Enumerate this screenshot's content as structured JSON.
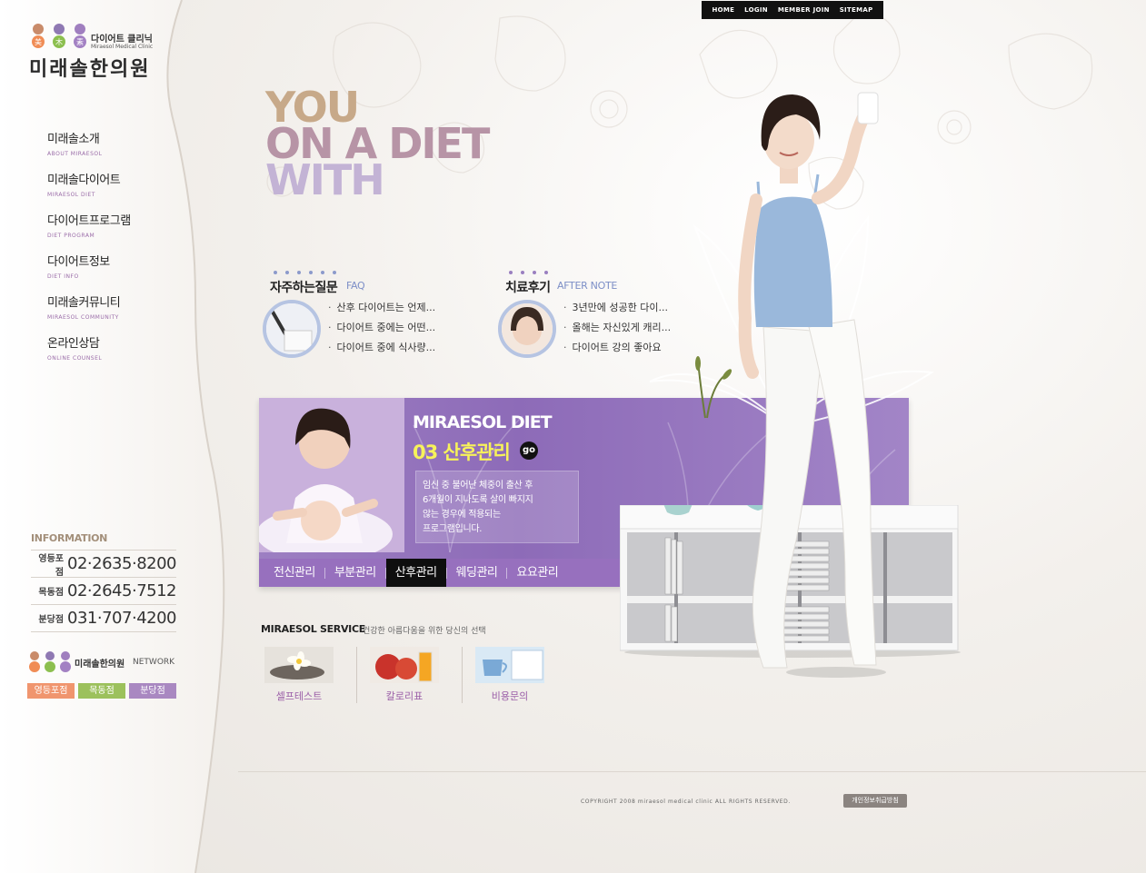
{
  "topnav": {
    "items": [
      "HOME",
      "LOGIN",
      "MEMBER JOIN",
      "SITEMAP"
    ]
  },
  "logo": {
    "subtitle": "다이어트 클리닉",
    "subtitle_en": "Miraesol Medical Clinic",
    "title": "미래솔한의원",
    "mark_glyphs": [
      "美",
      "木",
      "素"
    ]
  },
  "menu": [
    {
      "ko": "미래솔소개",
      "en": "ABOUT MIRAESOL"
    },
    {
      "ko": "미래솔다이어트",
      "en": "MIRAESOL DIET"
    },
    {
      "ko": "다이어트프로그램",
      "en": "DIET PROGRAM"
    },
    {
      "ko": "다이어트정보",
      "en": "DIET INFO"
    },
    {
      "ko": "미래솔커뮤니티",
      "en": "MIRAESOL COMMUNITY"
    },
    {
      "ko": "온라인상담",
      "en": "ONLINE COUNSEL"
    }
  ],
  "info": {
    "title": "INFORMATION",
    "rows": [
      {
        "branch": "영등포점",
        "phone": "02·2635·8200"
      },
      {
        "branch": "목동점",
        "phone": "02·2645·7512"
      },
      {
        "branch": "분당점",
        "phone": "031·707·4200"
      }
    ]
  },
  "network": {
    "name": "미래솔한의원",
    "label": "NETWORK",
    "buttons": [
      {
        "label": "영등포점",
        "color": "#f0956e"
      },
      {
        "label": "목동점",
        "color": "#9cc15c"
      },
      {
        "label": "분당점",
        "color": "#a988c1"
      }
    ]
  },
  "headline": {
    "lines": [
      "YOU",
      "ON A DIET",
      "WITH"
    ],
    "colors": [
      "#c7a989",
      "#b794a6",
      "#c3b3d5"
    ]
  },
  "faq": {
    "title": "자주하는질문",
    "sub": "FAQ",
    "items": [
      "산후 다이어트는 언제...",
      "다이어트 중에는 어떤...",
      "다이어트 중에 식사량..."
    ]
  },
  "after_note": {
    "title": "치료후기",
    "sub": "AFTER NOTE",
    "items": [
      "3년만에 성공한 다이...",
      "올해는 자신있게 캐리...",
      "다이어트 강의 좋아요"
    ]
  },
  "banner": {
    "title": "MIRAESOL DIET",
    "subtitle": "03 산후관리",
    "go": "go",
    "desc_lines": [
      "임신 중 불어난 체중이 출산 후",
      "6개월이 지나도록 살이 빠지지",
      "않는 경우에 적용되는",
      "프로그램입니다."
    ],
    "tabs": [
      "전신관리",
      "부분관리",
      "산후관리",
      "웨딩관리",
      "요요관리"
    ],
    "active_tab": 2
  },
  "service": {
    "title": "MIRAESOL SERVICE",
    "desc": "건강한 아름다움을 위한 당신의 선택",
    "items": [
      {
        "label": "셀프테스트",
        "icon": "flower-stone-icon"
      },
      {
        "label": "칼로리표",
        "icon": "apple-juice-icon"
      },
      {
        "label": "비용문의",
        "icon": "coffee-cup-icon"
      }
    ]
  },
  "footer": {
    "copyright": "COPYRIGHT 2008 miraesol medical clinic ALL RIGHTS RESERVED.",
    "privacy": "개인정보취급방침"
  },
  "colors": {
    "accent_purple": "#9770be",
    "banner_yellow": "#f7f25a",
    "faq_ring": "#b6c4e2",
    "menu_en": "#9a6ca8"
  }
}
